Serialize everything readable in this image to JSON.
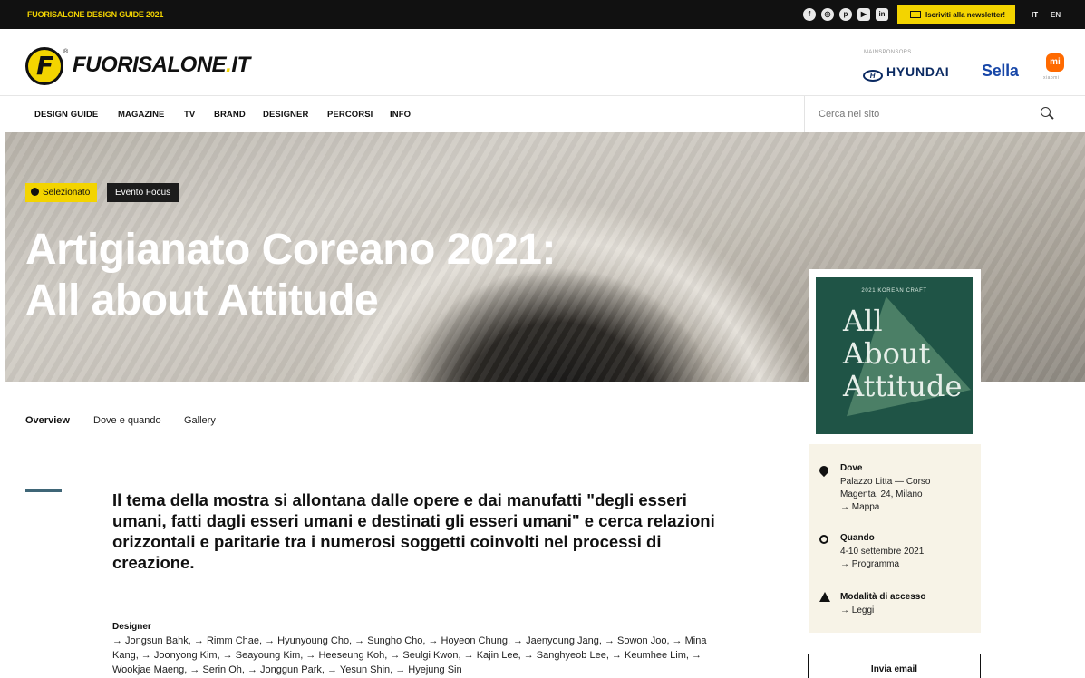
{
  "topbar": {
    "guide_label": "FUORISALONE DESIGN GUIDE 2021",
    "socials": [
      "f",
      "◎",
      "p",
      "▶",
      "in"
    ],
    "newsletter_label": "Iscriviti alla newsletter!",
    "lang_it": "IT",
    "lang_en": "EN"
  },
  "header": {
    "logo_letter": "F",
    "logo_reg": "®",
    "logo_text_main": "FUORISALONE",
    "logo_text_dot": ".",
    "logo_text_suffix": "IT",
    "sponsor_label": "MAINSPONSORS",
    "hyundai_mark": "H",
    "hyundai": "HYUNDAI",
    "sella": "Sella",
    "xiaomi_mark": "mi",
    "xiaomi_word": "xiaomi"
  },
  "nav": {
    "items": [
      "DESIGN GUIDE",
      "MAGAZINE",
      "TV",
      "BRAND",
      "DESIGNER",
      "PERCORSI",
      "INFO"
    ],
    "search_placeholder": "Cerca nel sito"
  },
  "hero": {
    "tag_selected": "Selezionato",
    "tag_focus": "Evento Focus",
    "title_line1": "Artigianato Coreano 2021:",
    "title_line2": "All about Attitude"
  },
  "poster": {
    "top": "2021 KOREAN CRAFT",
    "l1": "All",
    "l2": "About",
    "l3": "Attitude"
  },
  "info": {
    "dove_head": "Dove",
    "dove_l1": "Palazzo Litta — Corso",
    "dove_l2": "Magenta, 24, Milano",
    "dove_link": "→ Mappa",
    "quando_head": "Quando",
    "quando_l1": "4-10 settembre 2021",
    "quando_link": "→ Programma",
    "accesso_head": "Modalità di accesso",
    "accesso_link": "→ Leggi",
    "email_button": "Invia email"
  },
  "tabs": [
    "Overview",
    "Dove e quando",
    "Gallery"
  ],
  "content": {
    "intro": "Il tema della mostra si allontana dalle opere e dai manufatti \"degli esseri umani, fatti dagli esseri umani e destinati gli esseri umani\" e cerca relazioni orizzontali e paritarie tra i numerosi soggetti coinvolti nel processi di creazione.",
    "designer_head": "Designer",
    "designers": "→ Jongsun Bahk, → Rimm Chae, → Hyunyoung Cho, → Sungho Cho, → Hoyeon Chung, → Jaenyoung Jang, → Sowon Joo, → Mina Kang, → Joonyong Kim, → Seayoung Kim, → Heeseung Koh, → Seulgi Kwon, → Kajin Lee, → Sanghyeob Lee, → Keumhee Lim, → Wookjae Maeng, → Serin Oh, → Jonggun Park, → Yesun Shin, → Hyejung Sin"
  }
}
